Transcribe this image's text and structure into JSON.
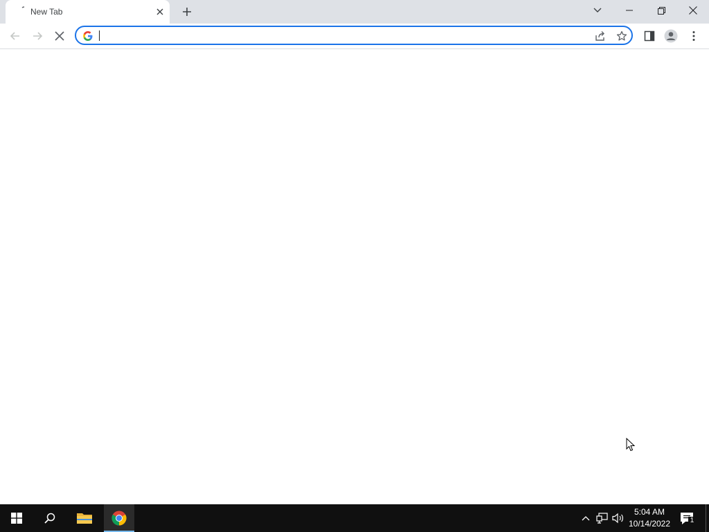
{
  "browser": {
    "tab": {
      "title": "New Tab"
    },
    "omnibox": {
      "value": "",
      "placeholder": ""
    }
  },
  "icons": {
    "back": "arrow-left-icon",
    "forward": "arrow-right-icon",
    "stop": "close-icon",
    "share": "share-icon",
    "bookmark": "star-icon",
    "side_panel": "side-panel-icon",
    "profile": "profile-icon",
    "menu": "kebab-menu-icon"
  },
  "taskbar": {
    "clock": {
      "time": "5:04 AM",
      "date": "10/14/2022"
    },
    "notifications": {
      "count": "1"
    }
  },
  "colors": {
    "tabstrip": "#dee1e6",
    "omnibox_focus": "#1a73e8",
    "taskbar": "#101010",
    "taskbar_active": "#76b9ed"
  }
}
